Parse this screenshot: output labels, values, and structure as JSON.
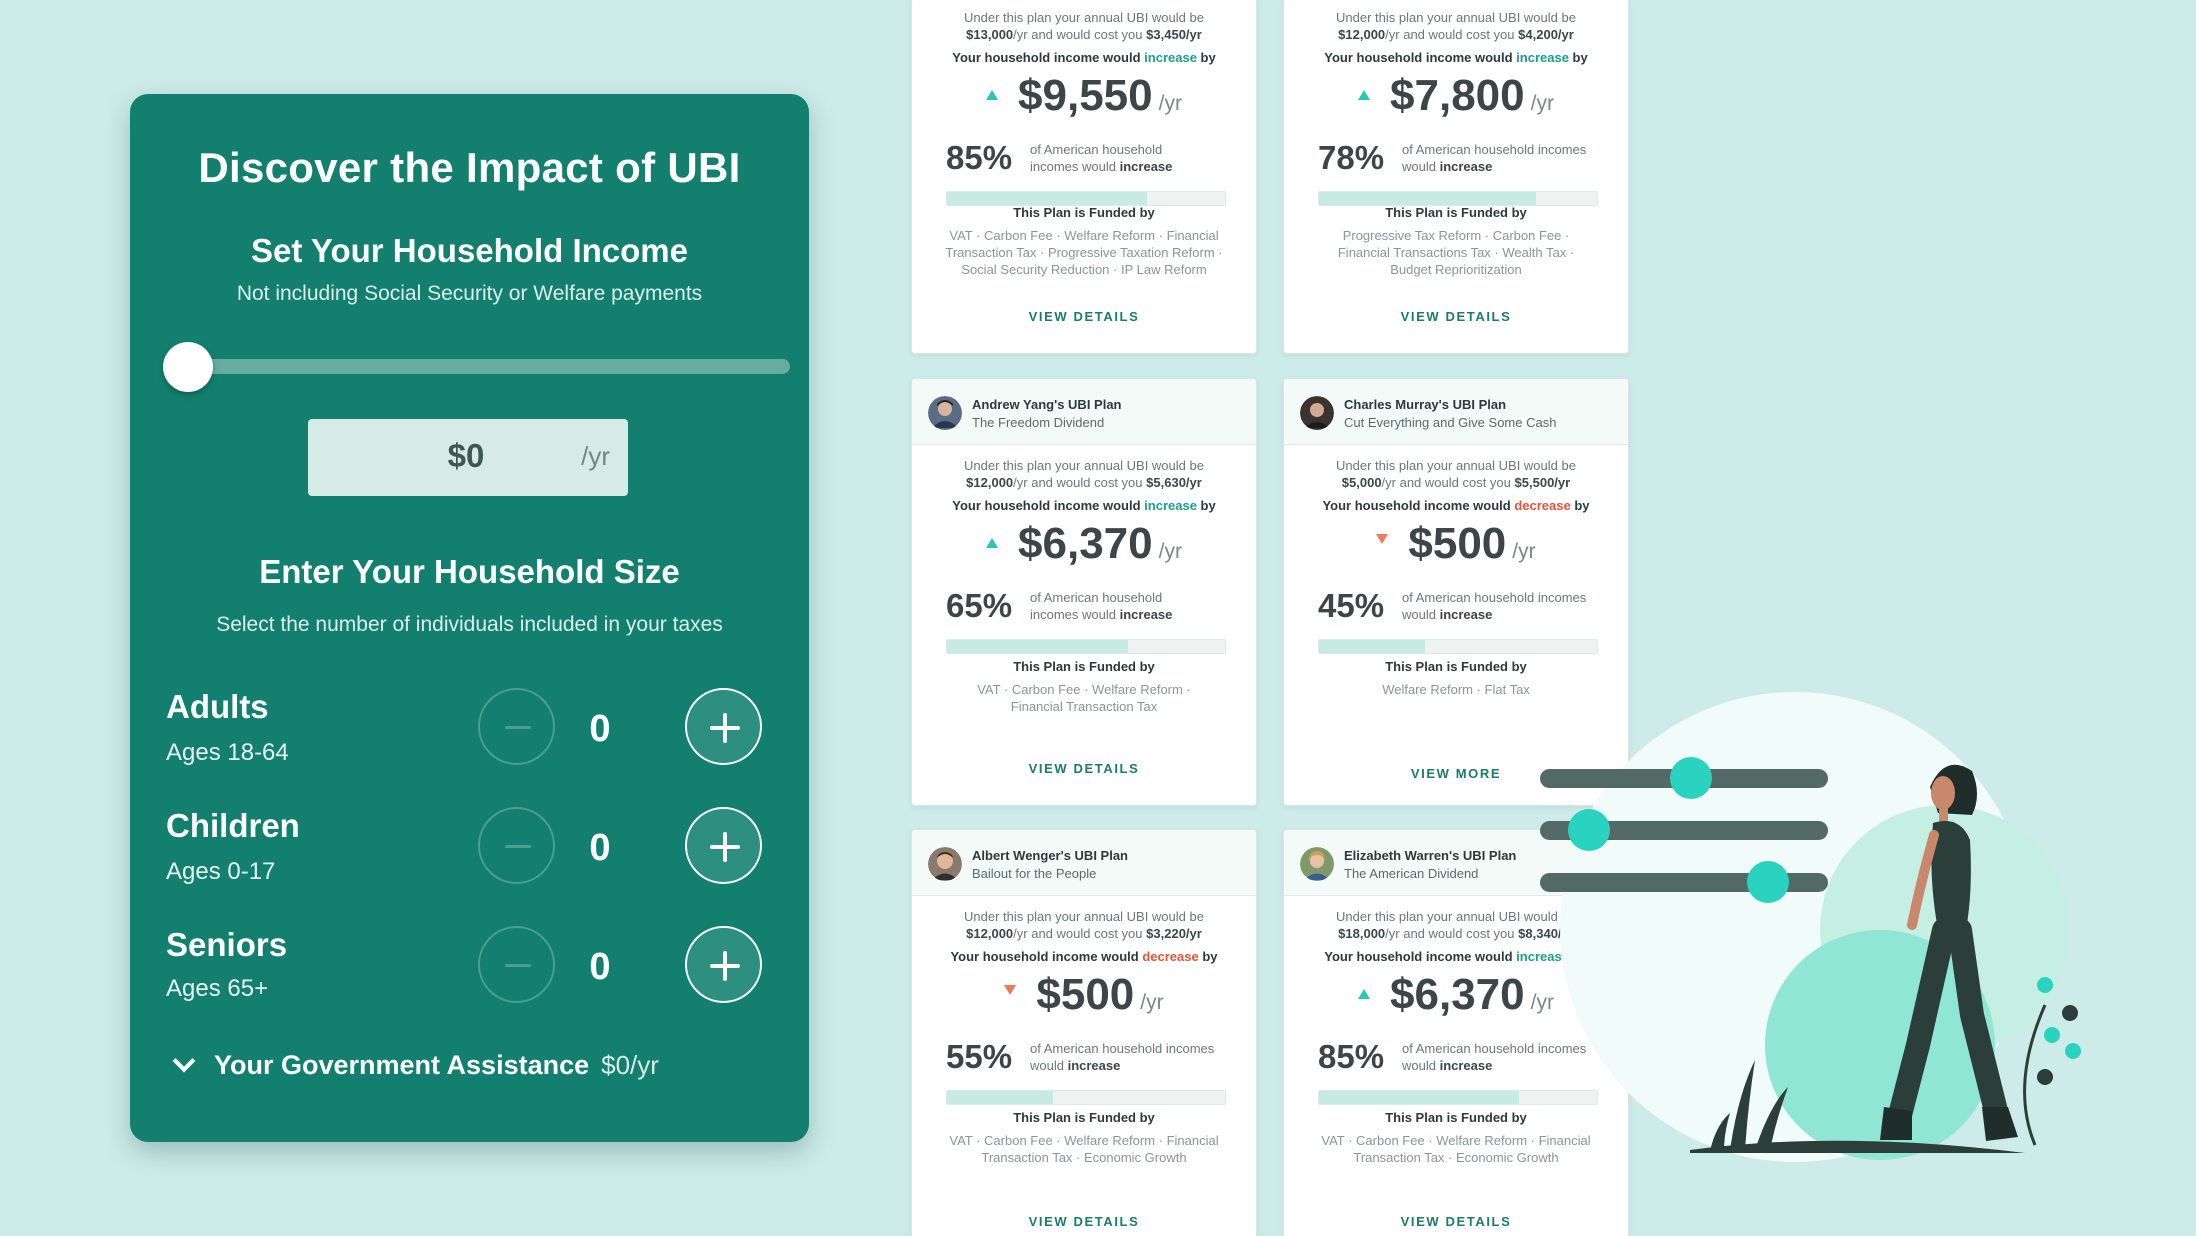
{
  "calculator": {
    "title": "Discover the Impact of UBI",
    "income_title": "Set Your Household Income",
    "income_subtitle": "Not including Social Security or Welfare payments",
    "income_value": "$0",
    "income_unit": "/yr",
    "income_slider_fraction": 0,
    "household_title": "Enter Your Household Size",
    "household_subtitle": "Select the number of individuals included in your taxes",
    "rows": [
      {
        "label": "Adults",
        "sub": "Ages 18-64",
        "count": "0"
      },
      {
        "label": "Children",
        "sub": "Ages 0-17",
        "count": "0"
      },
      {
        "label": "Seniors",
        "sub": "Ages 65+",
        "count": "0"
      }
    ],
    "assistance_label": "Your Government Assistance",
    "assistance_value": "$0/yr"
  },
  "common": {
    "would_prefix": "Your household income would",
    "would_suffix": "by",
    "funded_title": "This Plan is Funded by",
    "of_american": "of American household incomes would",
    "of_american_short": "of American household",
    "incomes_would": "incomes would",
    "increase": "increase",
    "decrease": "decrease",
    "under_prefix": "Under this plan your annual UBI would be",
    "cost_mid": "/yr and would cost you",
    "unit": "/yr"
  },
  "plans": [
    {
      "ubi": "$13,000",
      "cost": "$3,450/yr",
      "direction": "increase",
      "amount": "$9,550",
      "pct": "85%",
      "pct_value": 72,
      "funded": "VAT · Carbon Fee · Welfare Reform · Financial Transaction Tax · Progressive Taxation Reform · Social Security Reduction · IP Law Reform",
      "cta": "VIEW DETAILS"
    },
    {
      "ubi": "$12,000",
      "cost": "$4,200/yr",
      "direction": "increase",
      "amount": "$7,800",
      "pct": "78%",
      "pct_value": 78,
      "funded": "Progressive Tax Reform · Carbon Fee · Financial Transactions Tax · Wealth Tax · Budget Reprioritization",
      "cta": "VIEW DETAILS"
    },
    {
      "author": "Andrew Yang's UBI Plan",
      "name": "The Freedom Dividend",
      "ubi": "$12,000",
      "cost": "$5,630/yr",
      "direction": "increase",
      "amount": "$6,370",
      "pct": "65%",
      "pct_value": 65,
      "funded": "VAT · Carbon Fee · Welfare Reform · Financial Transaction Tax",
      "cta": "VIEW DETAILS"
    },
    {
      "author": "Charles Murray's UBI Plan",
      "name": "Cut Everything and Give Some Cash",
      "ubi": "$5,000",
      "cost": "$5,500/yr",
      "direction": "decrease",
      "amount": "$500",
      "pct": "45%",
      "pct_value": 38,
      "funded": "Welfare Reform · Flat Tax",
      "cta": "VIEW MORE"
    },
    {
      "author": "Albert Wenger's UBI Plan",
      "name": "Bailout for the People",
      "ubi": "$12,000",
      "cost": "$3,220/yr",
      "direction": "decrease",
      "amount": "$500",
      "pct": "55%",
      "pct_value": 38,
      "funded": "VAT · Carbon Fee · Welfare Reform · Financial Transaction Tax · Economic Growth",
      "cta": "VIEW DETAILS"
    },
    {
      "author": "Elizabeth Warren's UBI Plan",
      "name": "The American Dividend",
      "ubi": "$18,000",
      "cost": "$8,340/yr",
      "direction": "increase",
      "amount": "$6,370",
      "pct": "85%",
      "pct_value": 72,
      "funded": "VAT · Carbon Fee · Welfare Reform · Financial Transaction Tax · Economic Growth",
      "cta": "VIEW DETAILS"
    }
  ],
  "colors": {
    "panel": "#13806f",
    "page": "#cdebe8",
    "increase": "#1aa087",
    "decrease": "#e2553a",
    "accent_teal": "#2ad3bf"
  }
}
